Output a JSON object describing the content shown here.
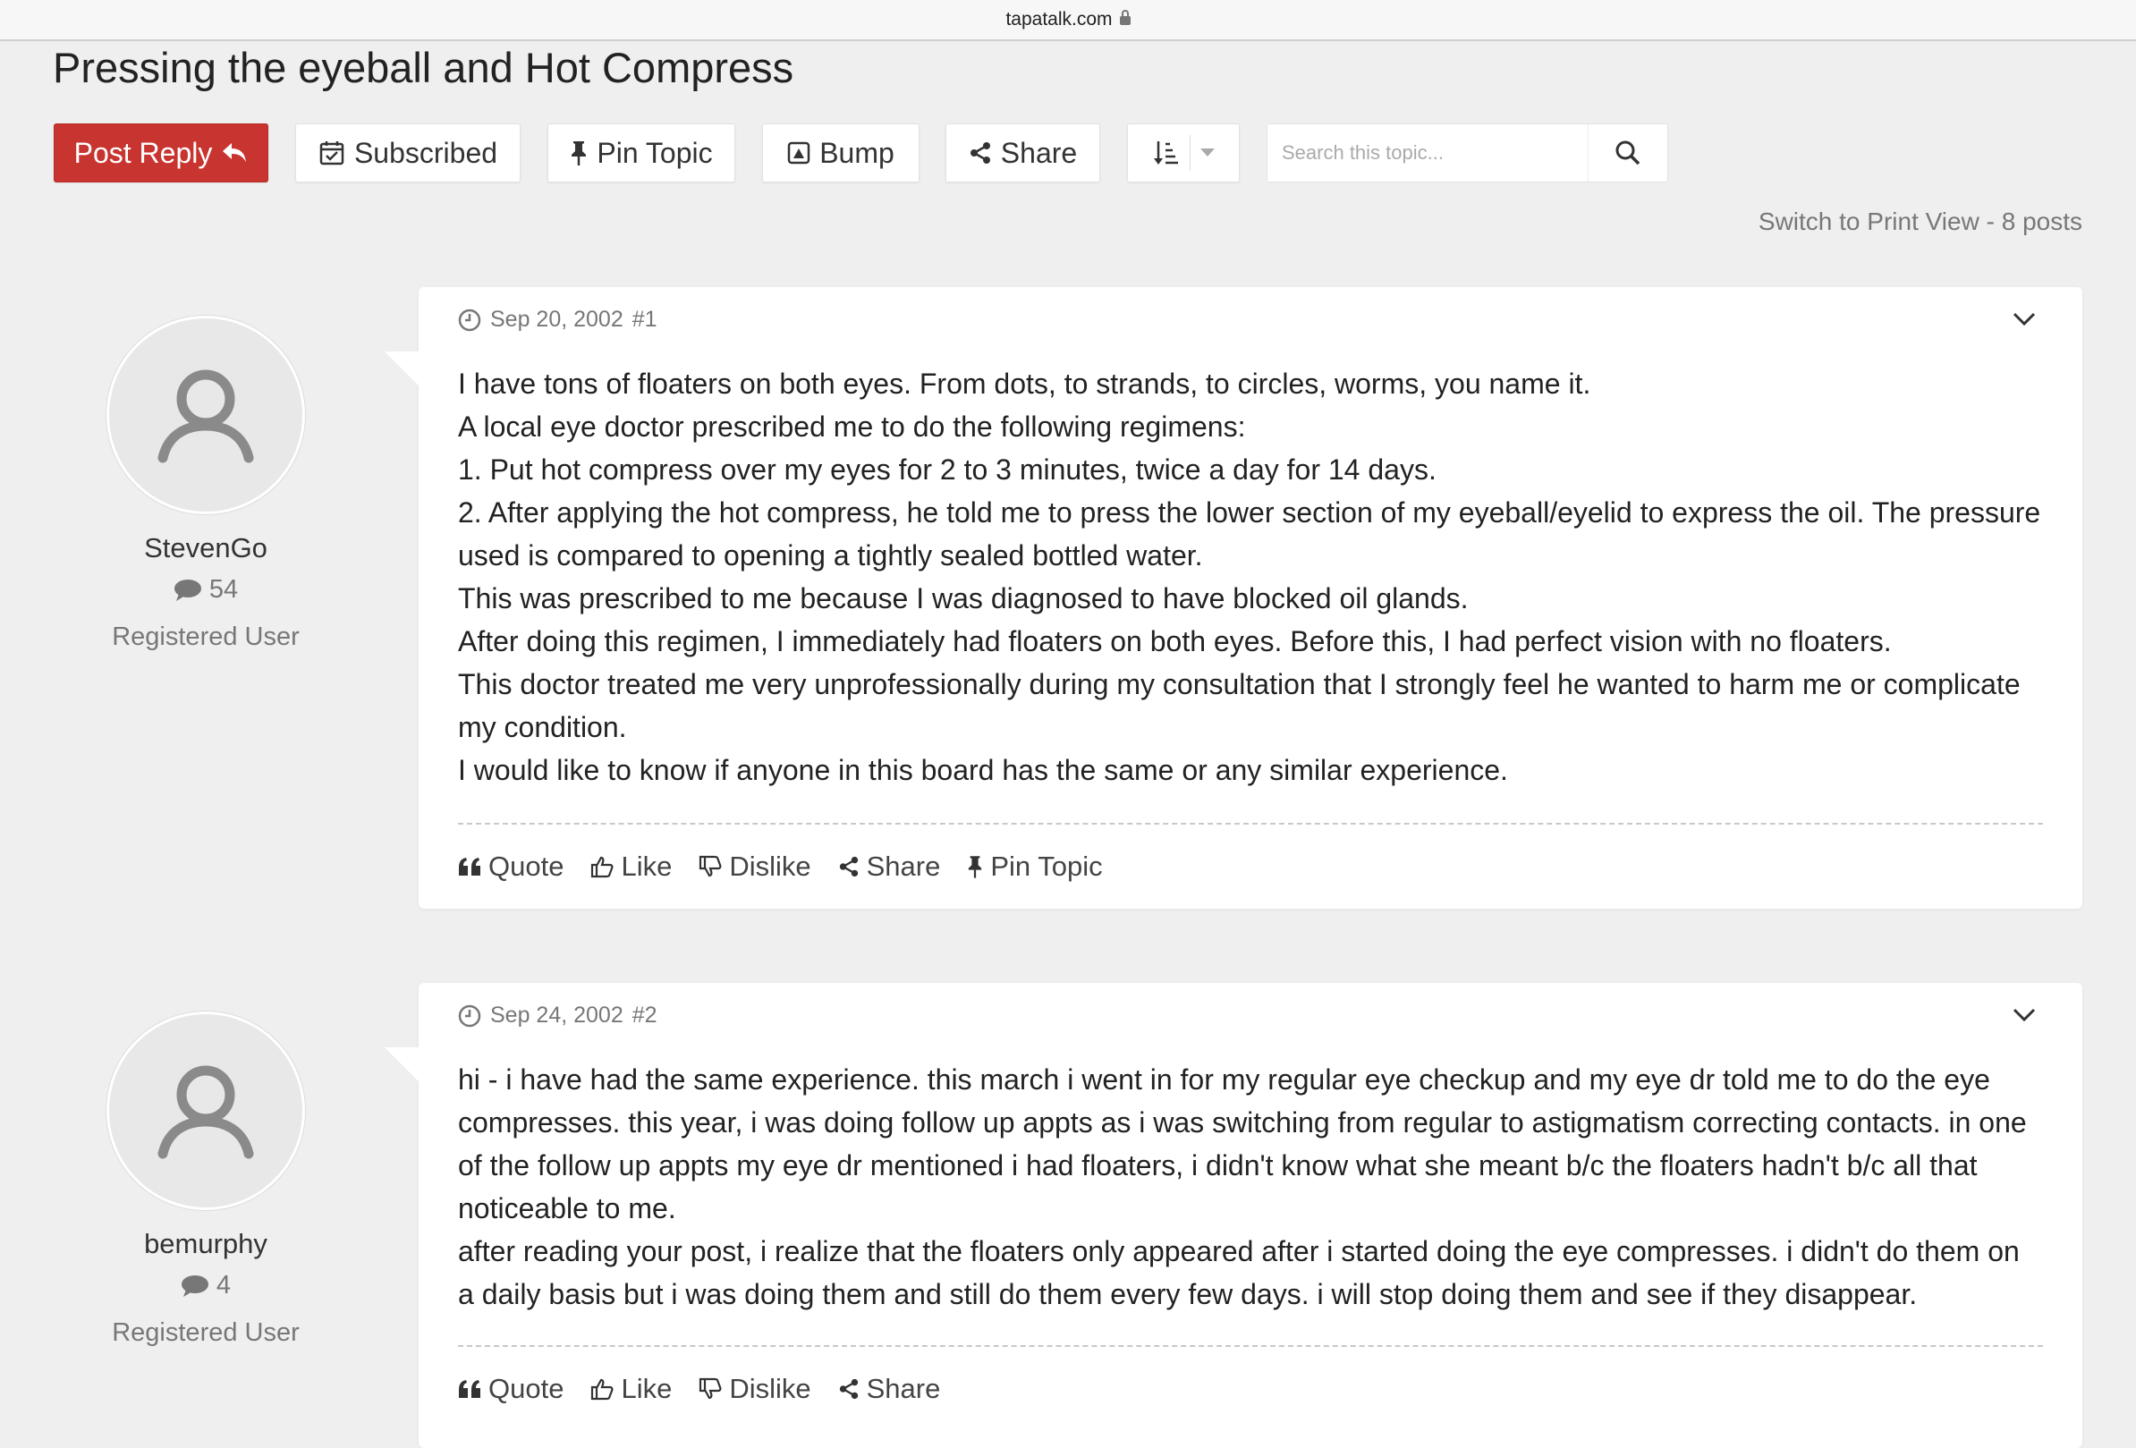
{
  "browser": {
    "url": "tapatalk.com"
  },
  "topic": {
    "title": "Pressing the eyeball and Hot Compress"
  },
  "toolbar": {
    "post_reply": "Post Reply",
    "subscribed": "Subscribed",
    "pin_topic": "Pin Topic",
    "bump": "Bump",
    "share": "Share",
    "search_placeholder": "Search this topic...",
    "print_view": "Switch to Print View",
    "post_count": "- 8 posts"
  },
  "posts": [
    {
      "author": "StevenGo",
      "author_post_count": "54",
      "author_role": "Registered User",
      "date": "Sep 20, 2002",
      "number": "#1",
      "lines": [
        "I have tons of floaters on both eyes. From dots, to strands, to circles, worms, you name it.",
        "A local eye doctor prescribed me to do the following regimens:",
        "1. Put hot compress over my eyes for 2 to 3 minutes, twice a day for 14 days.",
        "2. After applying the hot compress, he told me to press the lower section of my eyeball/eyelid to express the oil. The pressure used is compared to opening a tightly sealed bottled water.",
        "This was prescribed to me because I was diagnosed to have blocked oil glands.",
        "After doing this regimen, I immediately had floaters on both eyes. Before this, I had perfect vision with no floaters.",
        "This doctor treated me very unprofessionally during my consultation that I strongly feel he wanted to harm me or complicate my condition.",
        "I would like to know if anyone in this board has the same or any similar experience."
      ],
      "actions": {
        "quote": "Quote",
        "like": "Like",
        "dislike": "Dislike",
        "share": "Share",
        "pin": "Pin Topic"
      }
    },
    {
      "author": "bemurphy",
      "author_post_count": "4",
      "author_role": "Registered User",
      "date": "Sep 24, 2002",
      "number": "#2",
      "lines": [
        "hi - i have had the same experience. this march i went in for my regular eye checkup and my eye dr told me to do the eye compresses. this year, i was doing follow up appts as i was switching from regular to astigmatism correcting contacts. in one of the follow up appts my eye dr mentioned i had floaters, i didn't know what she meant b/c the floaters hadn't b/c all that noticeable to me.",
        "after reading your post, i realize that the floaters only appeared after i started doing the eye compresses. i didn't do them on a daily basis but i was doing them and still do them every few days. i will stop doing them and see if they disappear."
      ],
      "actions": {
        "quote": "Quote",
        "like": "Like",
        "dislike": "Dislike",
        "share": "Share"
      }
    }
  ],
  "colors": {
    "accent": "#c8342f",
    "background": "#efefef"
  }
}
